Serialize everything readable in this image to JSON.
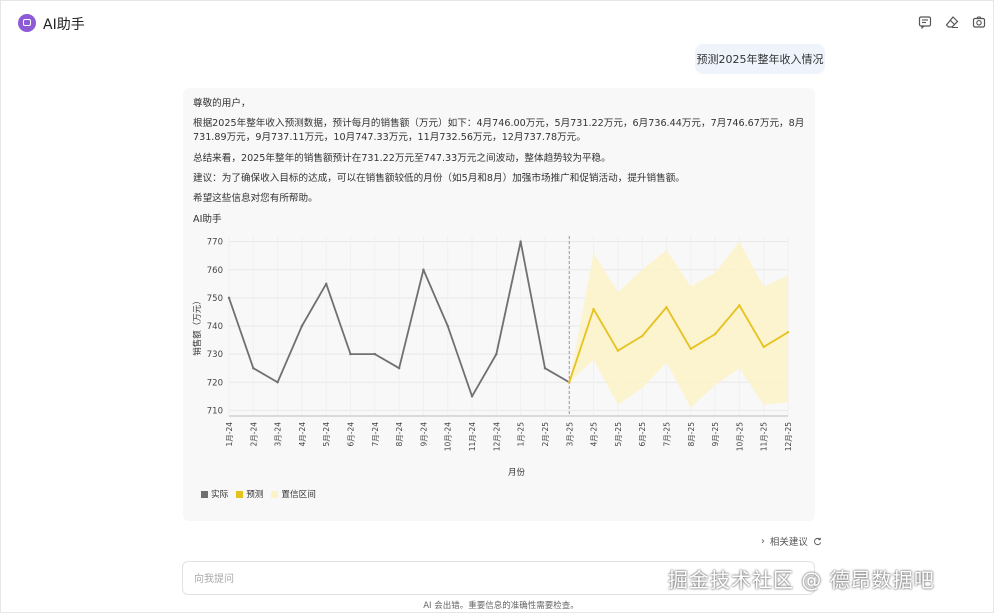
{
  "app": {
    "title": "AI助手"
  },
  "user_message": "预测2025年整年收入情况",
  "answer": {
    "greeting": "尊敬的用户，",
    "paragraph1": "根据2025年整年收入预测数据，预计每月的销售额（万元）如下：4月746.00万元，5月731.22万元，6月736.44万元，7月746.67万元，8月731.89万元，9月737.11万元，10月747.33万元，11月732.56万元，12月737.78万元。",
    "paragraph2": "总结来看，2025年整年的销售额预计在731.22万元至747.33万元之间波动，整体趋势较为平稳。",
    "paragraph3": "建议：为了确保收入目标的达成，可以在销售额较低的月份（如5月和8月）加强市场推广和促销活动，提升销售额。",
    "closing": "希望这些信息对您有所帮助。",
    "chart_caption": "AI助手"
  },
  "chart_data": {
    "type": "line",
    "xlabel": "月份",
    "ylabel": "销售额（万元）",
    "ylim": [
      708,
      772
    ],
    "yticks": [
      710,
      720,
      730,
      740,
      750,
      760,
      770
    ],
    "categories": [
      "1月-24",
      "2月-24",
      "3月-24",
      "4月-24",
      "5月-24",
      "6月-24",
      "7月-24",
      "8月-24",
      "9月-24",
      "10月-24",
      "11月-24",
      "12月-24",
      "1月-25",
      "2月-25",
      "3月-25",
      "4月-25",
      "5月-25",
      "6月-25",
      "7月-25",
      "8月-25",
      "9月-25",
      "10月-25",
      "11月-25",
      "12月-25"
    ],
    "series": [
      {
        "name": "实际",
        "color": "#707070",
        "start_index": 0,
        "values": [
          750,
          725,
          720,
          740,
          755,
          730,
          730,
          725,
          760,
          740,
          715,
          730,
          770,
          725,
          720
        ]
      },
      {
        "name": "预测",
        "color": "#e6c21f",
        "start_index": 14,
        "values": [
          720,
          746.0,
          731.22,
          736.44,
          746.67,
          731.89,
          737.11,
          747.33,
          732.56,
          737.78
        ]
      }
    ],
    "band": {
      "name": "置信区间",
      "color": "#fcf3c8",
      "start_index": 14,
      "lower": [
        720,
        728,
        712,
        718,
        727,
        711,
        719,
        725,
        712,
        713
      ],
      "upper": [
        720,
        766,
        752,
        760,
        767,
        754,
        759,
        770,
        754,
        758
      ]
    },
    "divider_index": 14,
    "legend_position": "bottom-left",
    "grid": true
  },
  "related_label": "相关建议",
  "input": {
    "placeholder": "向我提问"
  },
  "disclaimer": "AI 会出错。重要信息的准确性需要检查。",
  "watermark": "掘金技术社区 @ 德昂数据吧"
}
